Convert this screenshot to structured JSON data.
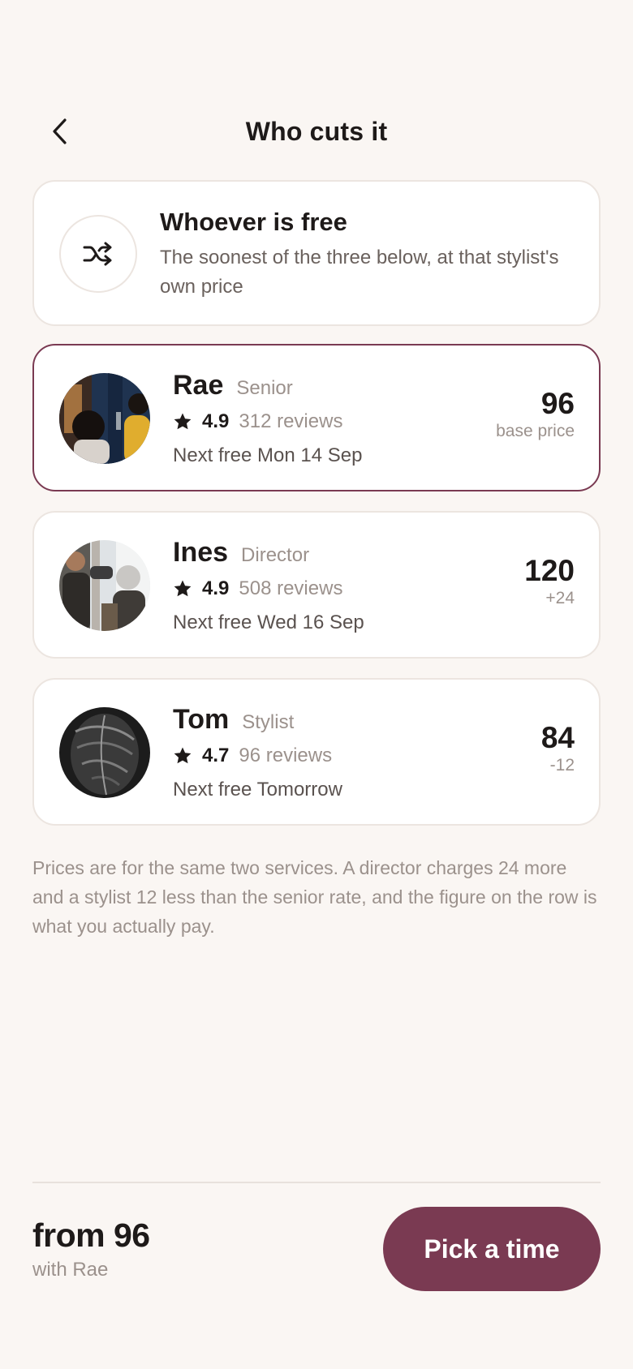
{
  "header": {
    "title": "Who cuts it"
  },
  "any_option": {
    "title": "Whoever is free",
    "subtitle": "The soonest of the three below, at that stylist's own price"
  },
  "stylists": [
    {
      "name": "Rae",
      "role": "Senior",
      "rating": "4.9",
      "reviews": "312 reviews",
      "next": "Next free Mon 14 Sep",
      "price": "96",
      "price_note": "base price",
      "selected": true
    },
    {
      "name": "Ines",
      "role": "Director",
      "rating": "4.9",
      "reviews": "508 reviews",
      "next": "Next free Wed 16 Sep",
      "price": "120",
      "price_note": "+24",
      "selected": false
    },
    {
      "name": "Tom",
      "role": "Stylist",
      "rating": "4.7",
      "reviews": "96 reviews",
      "next": "Next free Tomorrow",
      "price": "84",
      "price_note": "-12",
      "selected": false
    }
  ],
  "note": "Prices are for the same two services. A director charges 24 more and a stylist 12 less than the senior rate, and the figure on the row is what you actually pay.",
  "footer": {
    "price": "from 96",
    "with": "with Rae",
    "cta": "Pick a time"
  },
  "colors": {
    "accent": "#7a3a52",
    "background": "#faf6f3",
    "muted_text": "#9b918c"
  }
}
